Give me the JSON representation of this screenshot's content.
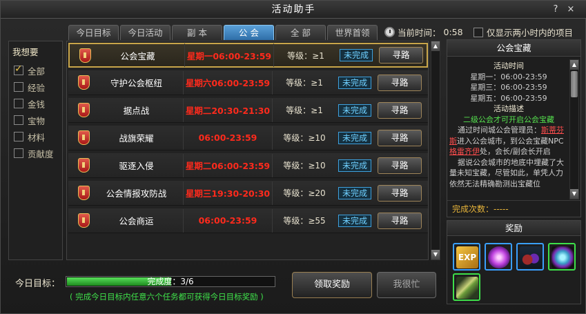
{
  "window": {
    "title": "活动助手",
    "help": "?",
    "close": "×"
  },
  "tabs": [
    {
      "label": "今日目标",
      "active": false
    },
    {
      "label": "今日活动",
      "active": false
    },
    {
      "label": "副 本",
      "active": false
    },
    {
      "label": "公 会",
      "active": true
    },
    {
      "label": "全 部",
      "active": false
    },
    {
      "label": "世界首领",
      "active": false
    }
  ],
  "current_time": {
    "label": "当前时间：",
    "value": "0:58"
  },
  "only_two_hours": {
    "label": "仅显示两小时内的项目",
    "checked": false
  },
  "filter": {
    "title": "我想要",
    "items": [
      {
        "label": "全部",
        "checked": true
      },
      {
        "label": "经验",
        "checked": false
      },
      {
        "label": "金钱",
        "checked": false
      },
      {
        "label": "宝物",
        "checked": false
      },
      {
        "label": "材料",
        "checked": false
      },
      {
        "label": "贡献度",
        "checked": false
      }
    ]
  },
  "activities": [
    {
      "name": "公会宝藏",
      "time": "星期一06:00-23:59",
      "level": "等级：≥1",
      "status": "未完成",
      "action": "寻路",
      "selected": true
    },
    {
      "name": "守护公会枢纽",
      "time": "星期六06:00-23:59",
      "level": "等级：≥1",
      "status": "未完成",
      "action": "寻路",
      "selected": false
    },
    {
      "name": "据点战",
      "time": "星期二20:30-21:30",
      "level": "等级：≥1",
      "status": "未完成",
      "action": "寻路",
      "selected": false
    },
    {
      "name": "战旗荣耀",
      "time": "06:00-23:59",
      "level": "等级：≥10",
      "status": "未完成",
      "action": "寻路",
      "selected": false
    },
    {
      "name": "驱逐入侵",
      "time": "星期二06:00-23:59",
      "level": "等级：≥10",
      "status": "未完成",
      "action": "寻路",
      "selected": false
    },
    {
      "name": "公会情报攻防战",
      "time": "星期三19:30-20:30",
      "level": "等级：≥20",
      "status": "未完成",
      "action": "寻路",
      "selected": false
    },
    {
      "name": "公会商运",
      "time": "06:00-23:59",
      "level": "等级：≥55",
      "status": "未完成",
      "action": "寻路",
      "selected": false
    }
  ],
  "detail": {
    "title": "公会宝藏",
    "time_heading": "活动时间",
    "times": [
      "星期一：06:00-23:59",
      "星期三：06:00-23:59",
      "星期五：06:00-23:59"
    ],
    "desc_heading": "活动描述",
    "highlight": "二级公会才可开启公会宝藏",
    "para1_a": "通过时间城公会管理员：",
    "para1_link1": "斯蒂芬斯",
    "para1_b": "进入公会城市，到公会宝藏NPC",
    "para1_link2": "格雷齐伊",
    "para1_c": "处，会长/副会长开启",
    "para2": "据说公会城市的地底中埋藏了大量未知宝藏，尽管如此，单凭人力依然无法精确勘测出宝藏位",
    "count_label": "完成次数：-----"
  },
  "reward": {
    "title": "奖励",
    "items": [
      {
        "icon": "exp-icon",
        "label": "EXP",
        "border": "#3aa0ff"
      },
      {
        "icon": "purple-orb-icon",
        "border": "#3aa0ff"
      },
      {
        "icon": "berries-icon",
        "border": "#3aa0ff"
      },
      {
        "icon": "gem-icon",
        "border": "#3ee04a"
      },
      {
        "icon": "feather-sword-icon",
        "border": "#3ee04a"
      }
    ]
  },
  "today_goal": {
    "label": "今日目标：",
    "progress_text": "完成度：3/6",
    "progress": 0.5,
    "hint": "( 完成今日目标内任意六个任务都可获得今日目标奖励 )"
  },
  "buttons": {
    "claim": "领取奖励",
    "busy": "我很忙"
  }
}
